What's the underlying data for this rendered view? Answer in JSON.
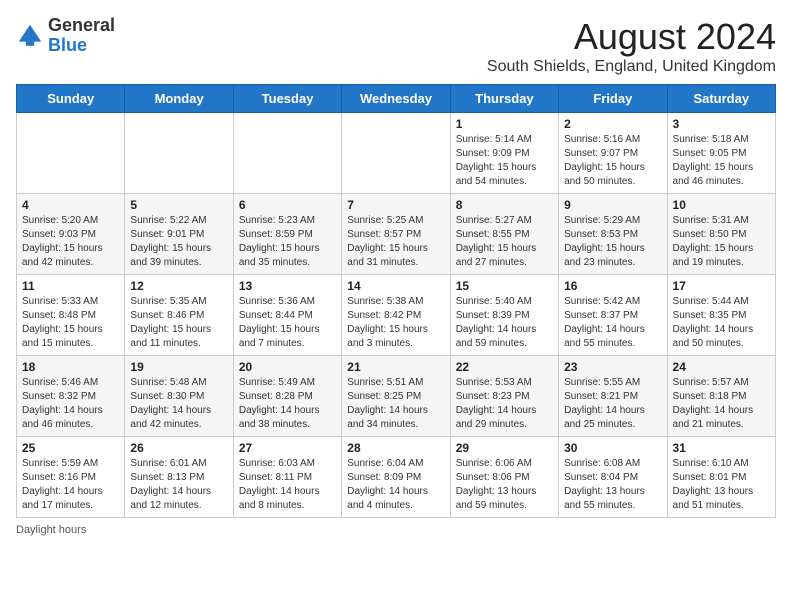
{
  "header": {
    "logo_general": "General",
    "logo_blue": "Blue",
    "month_year": "August 2024",
    "location": "South Shields, England, United Kingdom"
  },
  "weekdays": [
    "Sunday",
    "Monday",
    "Tuesday",
    "Wednesday",
    "Thursday",
    "Friday",
    "Saturday"
  ],
  "weeks": [
    [
      {
        "day": "",
        "info": ""
      },
      {
        "day": "",
        "info": ""
      },
      {
        "day": "",
        "info": ""
      },
      {
        "day": "",
        "info": ""
      },
      {
        "day": "1",
        "info": "Sunrise: 5:14 AM\nSunset: 9:09 PM\nDaylight: 15 hours\nand 54 minutes."
      },
      {
        "day": "2",
        "info": "Sunrise: 5:16 AM\nSunset: 9:07 PM\nDaylight: 15 hours\nand 50 minutes."
      },
      {
        "day": "3",
        "info": "Sunrise: 5:18 AM\nSunset: 9:05 PM\nDaylight: 15 hours\nand 46 minutes."
      }
    ],
    [
      {
        "day": "4",
        "info": "Sunrise: 5:20 AM\nSunset: 9:03 PM\nDaylight: 15 hours\nand 42 minutes."
      },
      {
        "day": "5",
        "info": "Sunrise: 5:22 AM\nSunset: 9:01 PM\nDaylight: 15 hours\nand 39 minutes."
      },
      {
        "day": "6",
        "info": "Sunrise: 5:23 AM\nSunset: 8:59 PM\nDaylight: 15 hours\nand 35 minutes."
      },
      {
        "day": "7",
        "info": "Sunrise: 5:25 AM\nSunset: 8:57 PM\nDaylight: 15 hours\nand 31 minutes."
      },
      {
        "day": "8",
        "info": "Sunrise: 5:27 AM\nSunset: 8:55 PM\nDaylight: 15 hours\nand 27 minutes."
      },
      {
        "day": "9",
        "info": "Sunrise: 5:29 AM\nSunset: 8:53 PM\nDaylight: 15 hours\nand 23 minutes."
      },
      {
        "day": "10",
        "info": "Sunrise: 5:31 AM\nSunset: 8:50 PM\nDaylight: 15 hours\nand 19 minutes."
      }
    ],
    [
      {
        "day": "11",
        "info": "Sunrise: 5:33 AM\nSunset: 8:48 PM\nDaylight: 15 hours\nand 15 minutes."
      },
      {
        "day": "12",
        "info": "Sunrise: 5:35 AM\nSunset: 8:46 PM\nDaylight: 15 hours\nand 11 minutes."
      },
      {
        "day": "13",
        "info": "Sunrise: 5:36 AM\nSunset: 8:44 PM\nDaylight: 15 hours\nand 7 minutes."
      },
      {
        "day": "14",
        "info": "Sunrise: 5:38 AM\nSunset: 8:42 PM\nDaylight: 15 hours\nand 3 minutes."
      },
      {
        "day": "15",
        "info": "Sunrise: 5:40 AM\nSunset: 8:39 PM\nDaylight: 14 hours\nand 59 minutes."
      },
      {
        "day": "16",
        "info": "Sunrise: 5:42 AM\nSunset: 8:37 PM\nDaylight: 14 hours\nand 55 minutes."
      },
      {
        "day": "17",
        "info": "Sunrise: 5:44 AM\nSunset: 8:35 PM\nDaylight: 14 hours\nand 50 minutes."
      }
    ],
    [
      {
        "day": "18",
        "info": "Sunrise: 5:46 AM\nSunset: 8:32 PM\nDaylight: 14 hours\nand 46 minutes."
      },
      {
        "day": "19",
        "info": "Sunrise: 5:48 AM\nSunset: 8:30 PM\nDaylight: 14 hours\nand 42 minutes."
      },
      {
        "day": "20",
        "info": "Sunrise: 5:49 AM\nSunset: 8:28 PM\nDaylight: 14 hours\nand 38 minutes."
      },
      {
        "day": "21",
        "info": "Sunrise: 5:51 AM\nSunset: 8:25 PM\nDaylight: 14 hours\nand 34 minutes."
      },
      {
        "day": "22",
        "info": "Sunrise: 5:53 AM\nSunset: 8:23 PM\nDaylight: 14 hours\nand 29 minutes."
      },
      {
        "day": "23",
        "info": "Sunrise: 5:55 AM\nSunset: 8:21 PM\nDaylight: 14 hours\nand 25 minutes."
      },
      {
        "day": "24",
        "info": "Sunrise: 5:57 AM\nSunset: 8:18 PM\nDaylight: 14 hours\nand 21 minutes."
      }
    ],
    [
      {
        "day": "25",
        "info": "Sunrise: 5:59 AM\nSunset: 8:16 PM\nDaylight: 14 hours\nand 17 minutes."
      },
      {
        "day": "26",
        "info": "Sunrise: 6:01 AM\nSunset: 8:13 PM\nDaylight: 14 hours\nand 12 minutes."
      },
      {
        "day": "27",
        "info": "Sunrise: 6:03 AM\nSunset: 8:11 PM\nDaylight: 14 hours\nand 8 minutes."
      },
      {
        "day": "28",
        "info": "Sunrise: 6:04 AM\nSunset: 8:09 PM\nDaylight: 14 hours\nand 4 minutes."
      },
      {
        "day": "29",
        "info": "Sunrise: 6:06 AM\nSunset: 8:06 PM\nDaylight: 13 hours\nand 59 minutes."
      },
      {
        "day": "30",
        "info": "Sunrise: 6:08 AM\nSunset: 8:04 PM\nDaylight: 13 hours\nand 55 minutes."
      },
      {
        "day": "31",
        "info": "Sunrise: 6:10 AM\nSunset: 8:01 PM\nDaylight: 13 hours\nand 51 minutes."
      }
    ]
  ],
  "footer": {
    "daylight_hours": "Daylight hours"
  }
}
